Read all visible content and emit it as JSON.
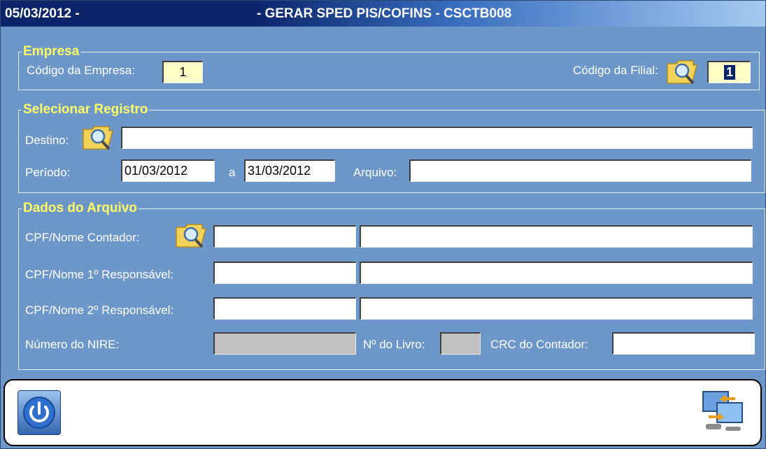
{
  "window": {
    "date": "05/03/2012 -",
    "title": "- GERAR SPED PIS/COFINS - CSCTB008"
  },
  "empresa": {
    "legend": "Empresa",
    "codigo_empresa_label": "Código da Empresa:",
    "codigo_empresa_value": "1",
    "codigo_filial_label": "Código da Filial:",
    "codigo_filial_value": "1"
  },
  "registro": {
    "legend": "Selecionar Registro",
    "destino_label": "Destino:",
    "destino_value": "",
    "periodo_label": "Período:",
    "periodo_inicio": "01/03/2012",
    "periodo_sep": "a",
    "periodo_fim": "31/03/2012",
    "arquivo_label": "Arquivo:",
    "arquivo_value": ""
  },
  "dados": {
    "legend": "Dados do Arquivo",
    "contador_label": "CPF/Nome Contador:",
    "resp1_label": "CPF/Nome 1º Responsável:",
    "resp2_label": "CPF/Nome 2º Responsável:",
    "nire_label": "Número do NIRE:",
    "livro_label": "Nº do Livro:",
    "crc_label": "CRC do Contador:"
  },
  "icons": {
    "folder": "folder-search-icon",
    "power": "power-icon",
    "execute": "computer-transfer-icon"
  }
}
